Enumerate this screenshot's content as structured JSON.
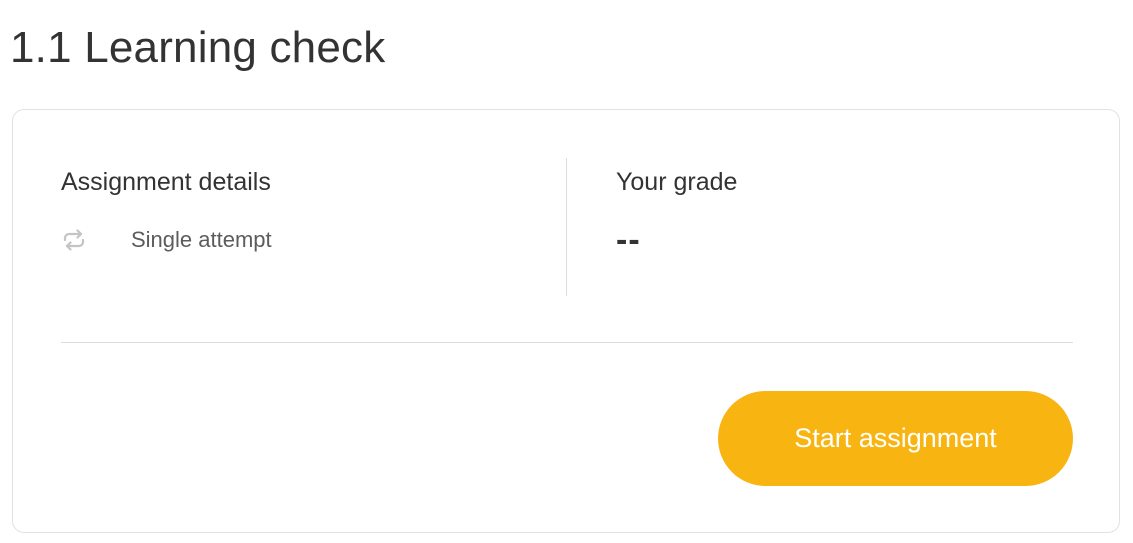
{
  "page": {
    "title": "1.1 Learning check"
  },
  "details": {
    "heading": "Assignment details",
    "attempt_icon": "repeat-icon",
    "attempt_text": "Single attempt"
  },
  "grade": {
    "heading": "Your grade",
    "value": "--"
  },
  "actions": {
    "start_label": "Start assignment"
  },
  "colors": {
    "accent": "#f8b512",
    "text": "#333333",
    "muted_icon": "#c4c4c4",
    "border": "#e2e2e2"
  }
}
